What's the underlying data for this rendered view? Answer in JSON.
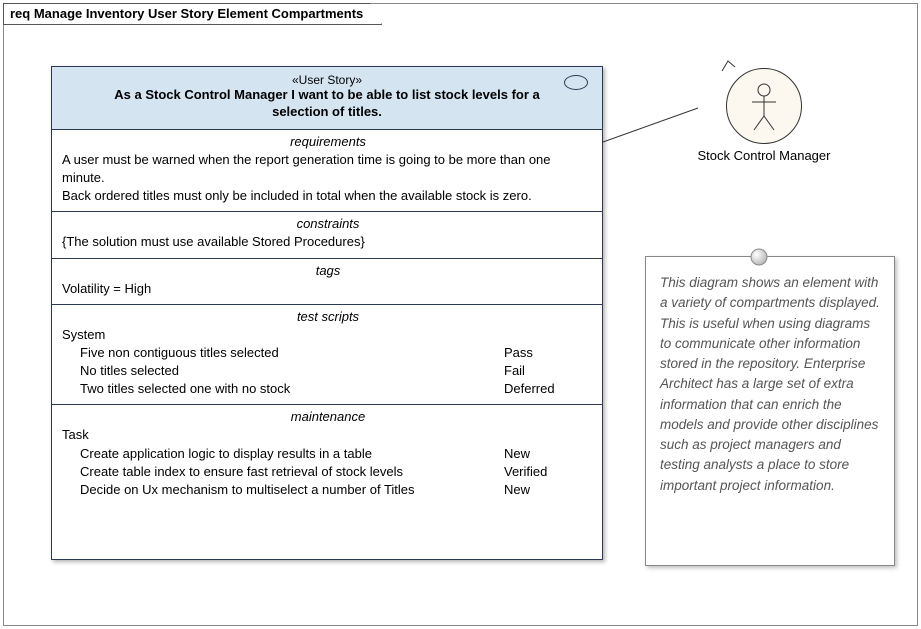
{
  "frame": {
    "title": "req Manage Inventory User Story Element Compartments"
  },
  "story": {
    "stereotype": "«User Story»",
    "description": "As a Stock Control Manager I want to be able to list stock levels for a selection of titles."
  },
  "compartments": {
    "requirements": {
      "title": "requirements",
      "items": [
        "A user must be warned when the report generation time is going to be more than one minute.",
        "Back ordered titles must only be included in total when the available stock is zero."
      ]
    },
    "constraints": {
      "title": "constraints",
      "body": "{The solution must use available Stored Procedures}"
    },
    "tags": {
      "title": "tags",
      "body": "Volatility = High"
    },
    "testscripts": {
      "title": "test scripts",
      "group": "System",
      "rows": [
        {
          "lbl": "Five non contiguous titles selected",
          "val": "Pass"
        },
        {
          "lbl": "No titles selected",
          "val": "Fail"
        },
        {
          "lbl": "Two titles selected one with no stock",
          "val": "Deferred"
        }
      ]
    },
    "maintenance": {
      "title": "maintenance",
      "group": "Task",
      "rows": [
        {
          "lbl": "Create application logic to display results in a table",
          "val": "New"
        },
        {
          "lbl": "Create table index to ensure fast retrieval of stock levels",
          "val": "Verified"
        },
        {
          "lbl": "Decide on Ux mechanism to multiselect a number of Titles",
          "val": "New"
        }
      ]
    }
  },
  "actor": {
    "label": "Stock Control Manager"
  },
  "note": {
    "text": "This diagram shows an element with a variety of compartments displayed. This is useful when using diagrams to communicate other information stored in the repository. Enterprise Architect has a large set of extra information that can enrich the models and provide other disciplines such as project managers and testing analysts a place to store important project information."
  }
}
